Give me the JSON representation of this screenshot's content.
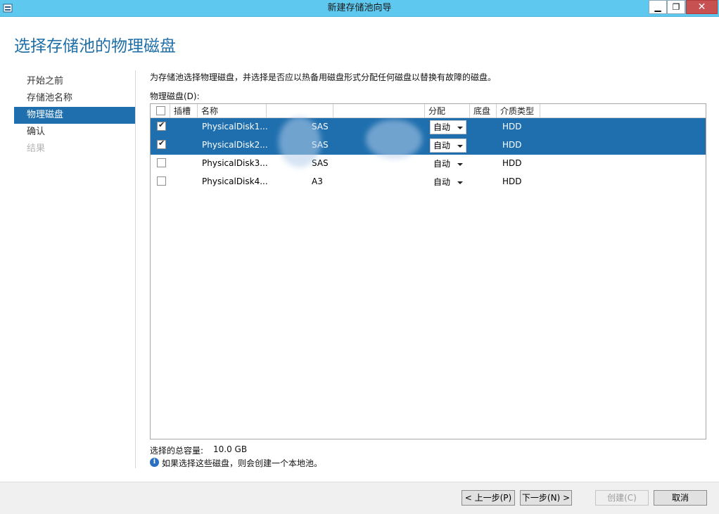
{
  "window": {
    "title": "新建存储池向导"
  },
  "page": {
    "title": "选择存储池的物理磁盘"
  },
  "nav": {
    "items": [
      {
        "label": "开始之前",
        "state": "normal"
      },
      {
        "label": "存储池名称",
        "state": "normal"
      },
      {
        "label": "物理磁盘",
        "state": "active"
      },
      {
        "label": "确认",
        "state": "normal"
      },
      {
        "label": "结果",
        "state": "disabled"
      }
    ]
  },
  "main": {
    "instruction": "为存储池选择物理磁盘，并选择是否应以热备用磁盘形式分配任何磁盘以替换有故障的磁盘。",
    "disks_label": "物理磁盘(D):",
    "columns": [
      "插槽",
      "名称",
      "分配",
      "底盘",
      "介质类型"
    ],
    "rows": [
      {
        "checked": true,
        "selected": true,
        "name": "PhysicalDisk1...",
        "bus": "SAS",
        "allocation": "自动",
        "media": "HDD"
      },
      {
        "checked": true,
        "selected": true,
        "name": "PhysicalDisk2...",
        "bus": "SAS",
        "allocation": "自动",
        "media": "HDD"
      },
      {
        "checked": false,
        "selected": false,
        "name": "PhysicalDisk3...",
        "bus": "SAS",
        "allocation": "自动",
        "media": "HDD"
      },
      {
        "checked": false,
        "selected": false,
        "name": "PhysicalDisk4...",
        "bus": "A3",
        "allocation": "自动",
        "media": "HDD"
      }
    ],
    "total_label": "选择的总容量:",
    "total_value": "10.0 GB",
    "info_text": "如果选择这些磁盘，则会创建一个本地池。"
  },
  "footer": {
    "prev": "< 上一步(P)",
    "next": "下一步(N) >",
    "create": "创建(C)",
    "cancel": "取消"
  },
  "colors": {
    "titlebar": "#5fc8ee",
    "accent": "#1f6fae",
    "title_text": "#1f6fa8"
  }
}
